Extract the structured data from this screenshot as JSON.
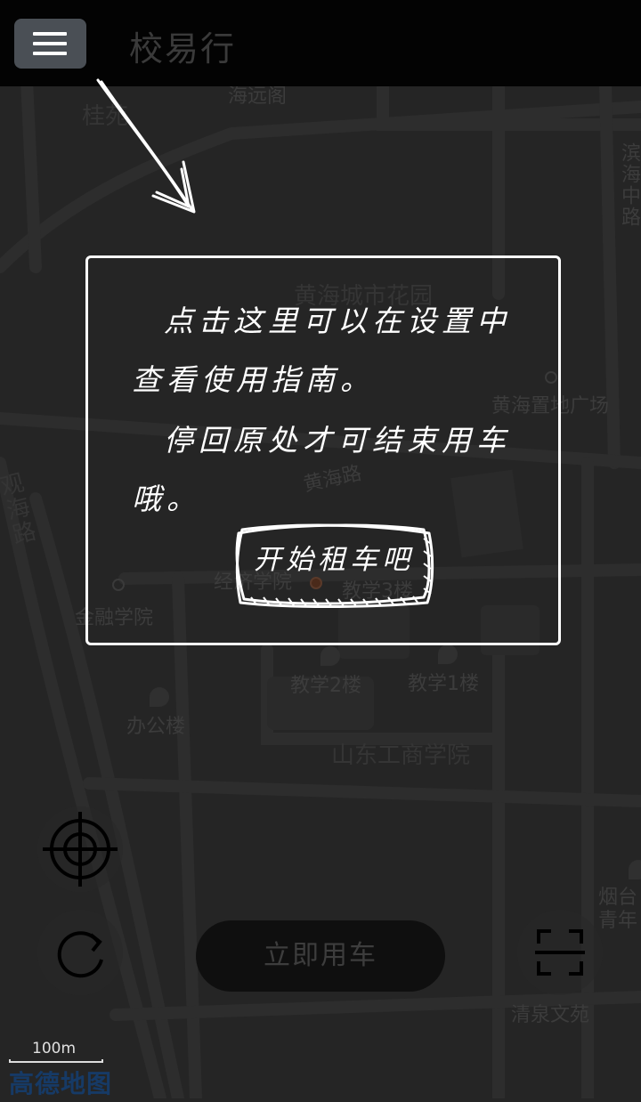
{
  "header": {
    "title": "校易行",
    "menu_icon": "hamburger-menu-icon"
  },
  "map": {
    "labels": [
      {
        "id": "guizhou-road",
        "text": "桂苑"
      },
      {
        "id": "haiyuange",
        "text": "海远阁"
      },
      {
        "id": "binhai-middle-road",
        "text": "滨海中路"
      },
      {
        "id": "huanghai-garden",
        "text": "黄海城市花园"
      },
      {
        "id": "huanghai-plaza",
        "text": "黄海置地广场"
      },
      {
        "id": "huanghai-road",
        "text": "黄海路"
      },
      {
        "id": "guanhai-road",
        "text": "观海路"
      },
      {
        "id": "economics-school",
        "text": "经济学院"
      },
      {
        "id": "teaching-building-3",
        "text": "教学3楼"
      },
      {
        "id": "finance-school",
        "text": "金融学院"
      },
      {
        "id": "teaching-building-2",
        "text": "教学2楼"
      },
      {
        "id": "teaching-building-1",
        "text": "教学1楼"
      },
      {
        "id": "office-building",
        "text": "办公楼"
      },
      {
        "id": "sdtbu",
        "text": "山东工商学院"
      },
      {
        "id": "yantai-youth",
        "text": "烟台青年"
      },
      {
        "id": "qingquan-garden",
        "text": "清泉文苑"
      }
    ],
    "scale_label": "100m",
    "brand": "高德地图"
  },
  "guide": {
    "line1": "点击这里可以在设置中",
    "line2": "查看使用指南。",
    "line3": "停回原处才可结束用车",
    "line4": "哦。",
    "button_label": "开始租车吧"
  },
  "controls": {
    "start_button": "立即用车",
    "locate_icon": "crosshair-locate-icon",
    "refresh_icon": "refresh-icon",
    "scan_icon": "scan-qr-icon"
  },
  "colors": {
    "header_bg": "#030303",
    "menu_button_bg": "#4a4f55",
    "overlay_bg": "#252525",
    "dialog_border": "#ffffff",
    "brand_blue": "#163a66"
  }
}
